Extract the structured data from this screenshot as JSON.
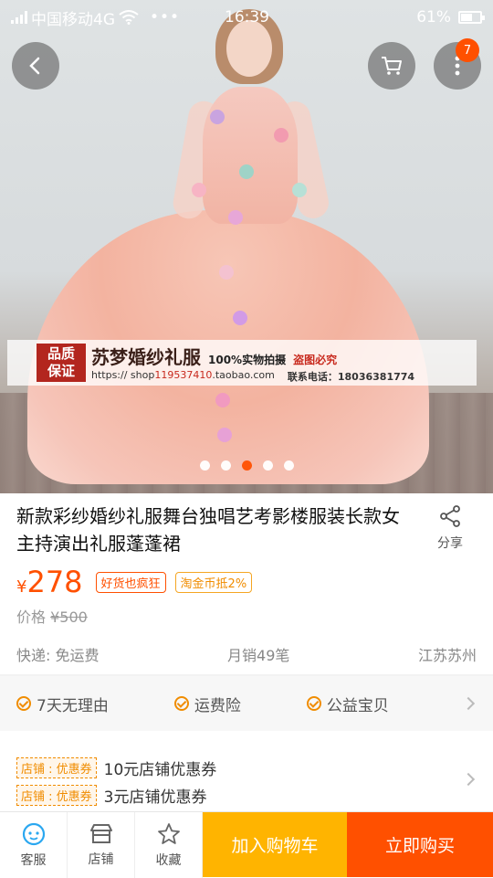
{
  "status_bar": {
    "carrier": "中国移动4G",
    "time": "16:39",
    "battery_percent": "61%",
    "battery_level": 0.61
  },
  "header": {
    "cart_badge": "7"
  },
  "hero": {
    "watermark": {
      "badge_line1": "品质",
      "badge_line2": "保证",
      "brand": "苏梦婚纱礼服",
      "real_shot": "100%实物拍摄",
      "no_steal": "盗图必究",
      "shop_url_prefix": "https:// shop",
      "shop_id": "119537410",
      "shop_url_suffix": ".taobao.com",
      "phone": "联系电话：18036381774"
    },
    "carousel_count": 5,
    "carousel_active": 3
  },
  "product": {
    "title": "新款彩纱婚纱礼服舞台独唱艺考影楼服装长款女主持演出礼服蓬蓬裙",
    "share_label": "分享",
    "currency": "¥",
    "price": "278",
    "tag1": "好货也疯狂",
    "tag2": "淘金币抵2%",
    "orig_label": "价格",
    "orig_price": "¥500",
    "shipping": "快递: 免运费",
    "monthly_sales": "月销49笔",
    "location": "江苏苏州"
  },
  "services": [
    "7天无理由",
    "运费险",
    "公益宝贝"
  ],
  "coupons": [
    {
      "tag": "店铺 : 优惠券",
      "text": "10元店铺优惠券"
    },
    {
      "tag": "店铺 : 优惠券",
      "text": "3元店铺优惠券"
    }
  ],
  "bottom_bar": {
    "service": "客服",
    "shop": "店铺",
    "favorite": "收藏",
    "add_cart": "加入购物车",
    "buy_now": "立即购买"
  },
  "colors": {
    "accent": "#ff5000",
    "cart_button": "#ffb400",
    "service_check": "#f08c00"
  }
}
